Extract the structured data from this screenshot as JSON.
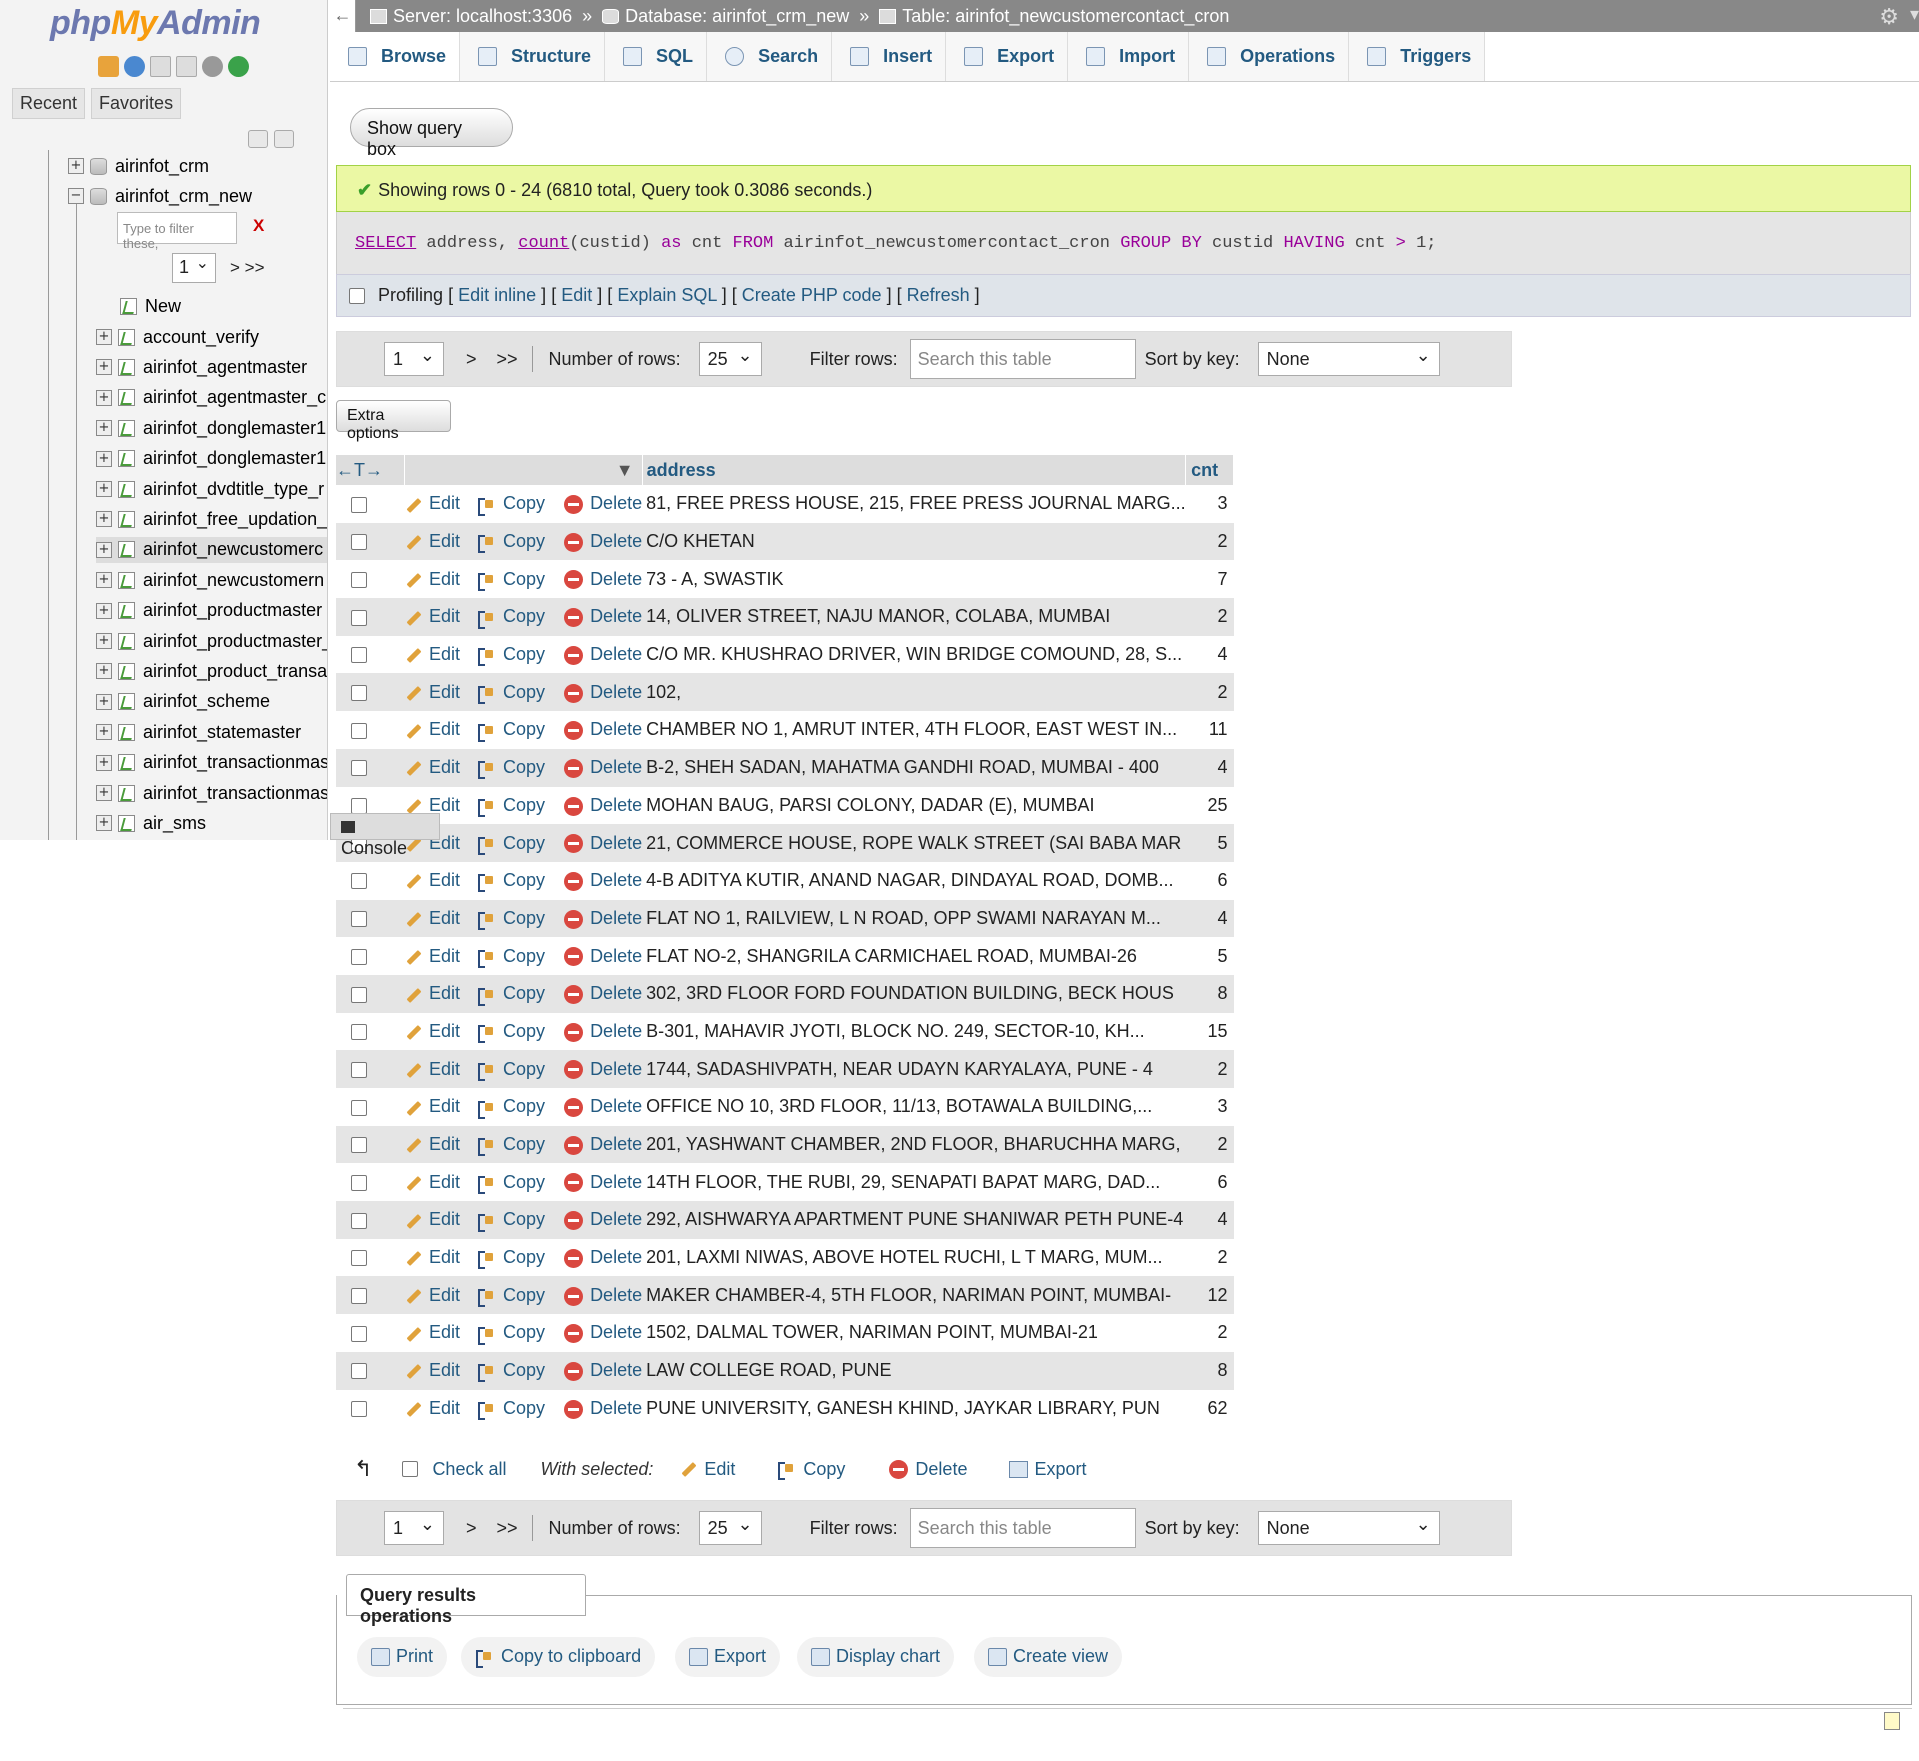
{
  "nav": {
    "logo_php": "php",
    "logo_my": "My",
    "logo_admin": "Admin",
    "tab_recent": "Recent",
    "tab_favorites": "Favorites",
    "filter_placeholder": "Type to filter these,",
    "filter_clear": "X",
    "page_select": "1",
    "page_next": "> >>",
    "databases": [
      "airinfot_crm",
      "airinfot_crm_new"
    ],
    "new_label": "New",
    "tables": [
      "account_verify",
      "airinfot_agentmaster",
      "airinfot_agentmaster_c",
      "airinfot_donglemaster1",
      "airinfot_donglemaster1",
      "airinfot_dvdtitle_type_r",
      "airinfot_free_updation_",
      "airinfot_newcustomerc",
      "airinfot_newcustomern",
      "airinfot_productmaster",
      "airinfot_productmaster_",
      "airinfot_product_transa",
      "airinfot_scheme",
      "airinfot_statemaster",
      "airinfot_transactionmas",
      "airinfot_transactionmas",
      "air_sms"
    ]
  },
  "breadcrumb": {
    "back": "←",
    "server": "Server: localhost:3306",
    "database": "Database: airinfot_crm_new",
    "table": "Table: airinfot_newcustomercontact_cron",
    "sep": "»"
  },
  "tabs": [
    "Browse",
    "Structure",
    "SQL",
    "Search",
    "Insert",
    "Export",
    "Import",
    "Operations",
    "Triggers"
  ],
  "show_query_box": "Show query box",
  "success_message": "Showing rows 0 - 24 (6810 total, Query took 0.3086 seconds.)",
  "sql": {
    "select": "SELECT",
    "p1": " address, ",
    "count": "count",
    "p2": "(custid) ",
    "as": "as",
    "p3": " cnt ",
    "from": "FROM",
    "p4": " airinfot_newcustomercontact_cron ",
    "groupby": "GROUP BY",
    "p5": " custid ",
    "having": "HAVING",
    "p6": " cnt ",
    "gt": ">",
    "p7": " 1;"
  },
  "profiling": {
    "label": "Profiling",
    "edit_inline": "Edit inline",
    "edit": "Edit",
    "explain": "Explain SQL",
    "php": "Create PHP code",
    "refresh": "Refresh",
    "lb": "[",
    "rb": "]"
  },
  "paging": {
    "page": "1",
    "next": ">",
    "last": ">>",
    "rows_label": "Number of rows:",
    "rows_value": "25",
    "filter_label": "Filter rows:",
    "filter_placeholder": "Search this table",
    "sort_label": "Sort by key:",
    "sort_value": "None"
  },
  "extra_options": "Extra options",
  "columns": {
    "arrows": "←T→",
    "address": "address",
    "cnt": "cnt"
  },
  "row_actions": {
    "edit": "Edit",
    "copy": "Copy",
    "delete": "Delete"
  },
  "rows": [
    {
      "address": "81, FREE PRESS HOUSE, 215, FREE PRESS JOURNAL MARG...",
      "cnt": "3"
    },
    {
      "address": "C/O KHETAN",
      "cnt": "2"
    },
    {
      "address": "73 - A, SWASTIK",
      "cnt": "7"
    },
    {
      "address": "14, OLIVER STREET, NAJU MANOR, COLABA, MUMBAI",
      "cnt": "2"
    },
    {
      "address": "C/O MR. KHUSHRAO DRIVER, WIN BRIDGE COMOUND, 28, S...",
      "cnt": "4"
    },
    {
      "address": "102,",
      "cnt": "2"
    },
    {
      "address": "CHAMBER NO 1, AMRUT INTER, 4TH FLOOR, EAST WEST IN...",
      "cnt": "11"
    },
    {
      "address": "B-2, SHEH SADAN, MAHATMA GANDHI ROAD, MUMBAI - 400",
      "cnt": "4"
    },
    {
      "address": "MOHAN BAUG, PARSI COLONY, DADAR (E), MUMBAI",
      "cnt": "25"
    },
    {
      "address": "21, COMMERCE HOUSE, ROPE WALK STREET (SAI BABA MAR",
      "cnt": "5"
    },
    {
      "address": "4-B ADITYA KUTIR, ANAND NAGAR, DINDAYAL ROAD, DOMB...",
      "cnt": "6"
    },
    {
      "address": "FLAT NO 1, RAILVIEW, L N ROAD, OPP SWAMI NARAYAN M...",
      "cnt": "4"
    },
    {
      "address": "FLAT NO-2, SHANGRILA CARMICHAEL ROAD, MUMBAI-26",
      "cnt": "5"
    },
    {
      "address": "302, 3RD FLOOR FORD FOUNDATION BUILDING, BECK HOUS",
      "cnt": "8"
    },
    {
      "address": "B-301, MAHAVIR JYOTI, BLOCK NO. 249, SECTOR-10, KH...",
      "cnt": "15"
    },
    {
      "address": "1744, SADASHIVPATH, NEAR UDAYN KARYALAYA, PUNE - 4",
      "cnt": "2"
    },
    {
      "address": "OFFICE NO 10, 3RD FLOOR, 11/13, BOTAWALA BUILDING,...",
      "cnt": "3"
    },
    {
      "address": "201, YASHWANT CHAMBER, 2ND FLOOR, BHARUCHHA MARG,",
      "cnt": "2"
    },
    {
      "address": "14TH FLOOR, THE RUBI, 29, SENAPATI BAPAT MARG, DAD...",
      "cnt": "6"
    },
    {
      "address": "292, AISHWARYA APARTMENT PUNE SHANIWAR PETH PUNE-4",
      "cnt": "4"
    },
    {
      "address": "201, LAXMI NIWAS, ABOVE HOTEL RUCHI, L T MARG, MUM...",
      "cnt": "2"
    },
    {
      "address": "MAKER CHAMBER-4, 5TH FLOOR, NARIMAN POINT, MUMBAI-",
      "cnt": "12"
    },
    {
      "address": "1502, DALMAL TOWER, NARIMAN POINT, MUMBAI-21",
      "cnt": "2"
    },
    {
      "address": "LAW COLLEGE ROAD, PUNE",
      "cnt": "8"
    },
    {
      "address": "PUNE UNIVERSITY, GANESH KHIND, JAYKAR LIBRARY, PUN",
      "cnt": "62"
    }
  ],
  "bulk": {
    "check_all": "Check all",
    "with_selected": "With selected:",
    "edit": "Edit",
    "copy": "Copy",
    "delete": "Delete",
    "export": "Export"
  },
  "console": "Console",
  "qro": {
    "title": "Query results operations",
    "print": "Print",
    "copy": "Copy to clipboard",
    "export": "Export",
    "chart": "Display chart",
    "view": "Create view"
  }
}
